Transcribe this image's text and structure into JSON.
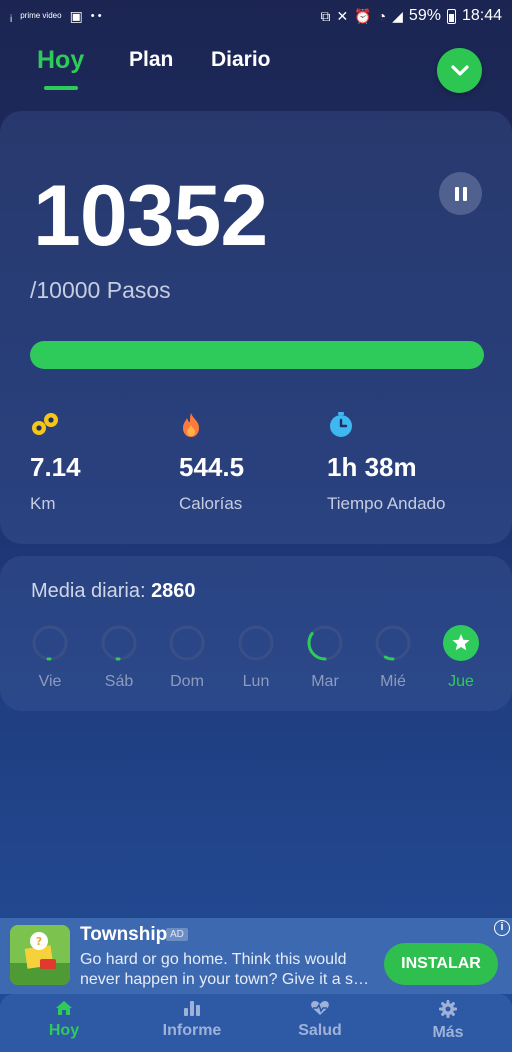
{
  "status_bar": {
    "left_prime": "prime video",
    "dots": "• •",
    "battery": "59%",
    "time": "18:44"
  },
  "tabs": [
    {
      "label": "Hoy",
      "active": true
    },
    {
      "label": "Plan",
      "active": false
    },
    {
      "label": "Diario",
      "active": false
    }
  ],
  "today": {
    "steps": "10352",
    "goal_label": "/10000 Pasos",
    "progress": 1.0,
    "stats": [
      {
        "icon": "route-icon",
        "value": "7.14",
        "label": "Km"
      },
      {
        "icon": "flame-icon",
        "value": "544.5",
        "label": "Calorías"
      },
      {
        "icon": "stopwatch-icon",
        "value": "1h 38m",
        "label": "Tiempo Andado"
      }
    ]
  },
  "week": {
    "avg_label": "Media diaria: ",
    "avg_value": "2860",
    "days": [
      {
        "label": "Vie",
        "progress": 0.02,
        "today": false
      },
      {
        "label": "Sáb",
        "progress": 0.02,
        "today": false
      },
      {
        "label": "Dom",
        "progress": 0.0,
        "today": false
      },
      {
        "label": "Lun",
        "progress": 0.0,
        "today": false
      },
      {
        "label": "Mar",
        "progress": 0.35,
        "today": false
      },
      {
        "label": "Mié",
        "progress": 0.08,
        "today": false
      },
      {
        "label": "Jue",
        "progress": 1.0,
        "today": true
      }
    ]
  },
  "ad": {
    "title": "Township",
    "badge": "AD",
    "description": "Go hard or go home. Think this would never happen in your town? Give it a s…",
    "button": "INSTALAR"
  },
  "bottom_nav": [
    {
      "label": "Hoy",
      "icon": "home-icon",
      "active": true
    },
    {
      "label": "Informe",
      "icon": "bar-chart-icon",
      "active": false
    },
    {
      "label": "Salud",
      "icon": "heart-pulse-icon",
      "active": false
    },
    {
      "label": "Más",
      "icon": "gear-icon",
      "active": false
    }
  ],
  "colors": {
    "accent": "#2fcb5a",
    "background_top": "#1c2552",
    "background_bottom": "#234b96",
    "ad_background": "#3d69b1",
    "nav_background": "#2e5aa5"
  }
}
